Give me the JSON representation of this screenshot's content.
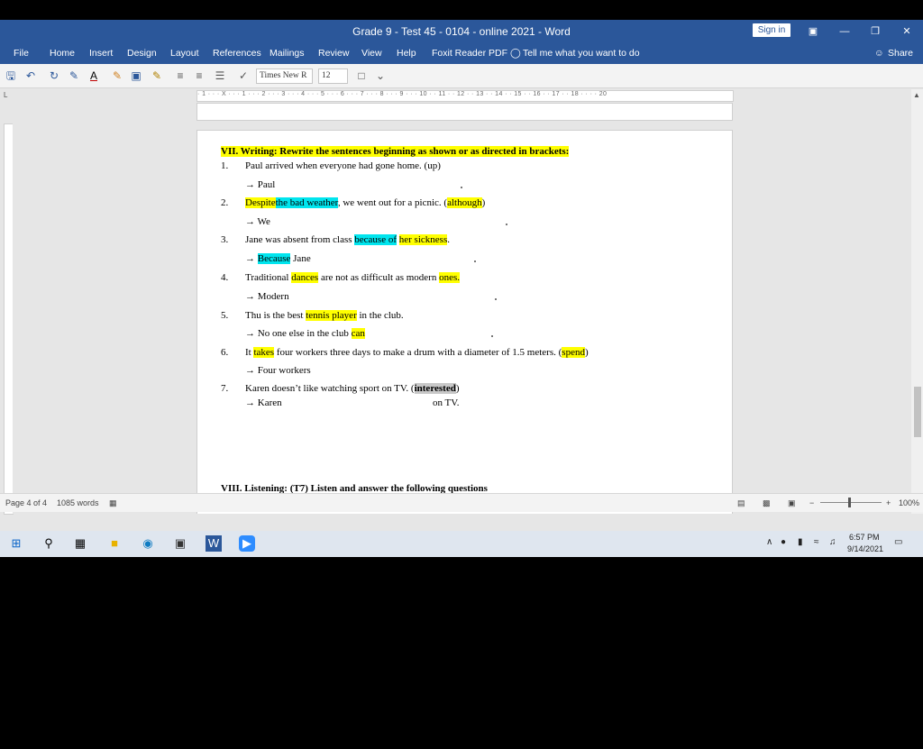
{
  "window": {
    "title": "Grade 9 - Test 45 - 0104 - online 2021  -  Word",
    "sign_in": "Sign in"
  },
  "ribbon": {
    "tabs": [
      "File",
      "Home",
      "Insert",
      "Design",
      "Layout",
      "References",
      "Mailings",
      "Review",
      "View",
      "Help",
      "Foxit Reader PDF"
    ],
    "tell_me": "Tell me what you want to do",
    "share": "Share"
  },
  "qat": {
    "font_name": "Times New R",
    "font_size": "12"
  },
  "ruler": {
    "labels": "· 1 · · · X · · · 1 · · · 2 · · · 3 · · · 4 · · · 5 · · · 6 · · · 7 · · · 8 · · · 9 · · · 10 · · 11 · · 12 · · 13 · · 14 · · 15 · · 16 · · 17 · · 18 · · · · 20"
  },
  "document": {
    "section_vii": "VII. Writing: Rewrite the sentences beginning as shown or as directed in brackets:",
    "items": [
      {
        "num": "1.",
        "s1": "Paul arrived when everyone had gone home. (up)",
        "arrow": "→ Paul"
      },
      {
        "num": "2.",
        "despite": "Despite",
        "bad_weather": "the bad weather",
        "rest": ", we went out for a picnic. (",
        "although": "although",
        "close": ")",
        "arrow": "→ We"
      },
      {
        "num": "3.",
        "pre": "Jane was absent from class ",
        "because_of": "because of",
        "her_sickness": "her sickness",
        "end": ".",
        "arrow": "→ ",
        "because": "Because",
        "arrow_rest": " Jane"
      },
      {
        "num": "4.",
        "pre": "Traditional ",
        "dances": "dances",
        "mid": " are not as difficult as modern ",
        "ones": "ones.",
        "arrow": "→ Modern"
      },
      {
        "num": "5.",
        "pre": "Thu is the best ",
        "tennis_player": "tennis player",
        "post": " in the club.",
        "arrow": "→ No one else in the club ",
        "can": "can"
      },
      {
        "num": "6.",
        "pre": "It ",
        "takes": "takes",
        "mid": " four workers three days to make a drum with a diameter of 1.5 meters. (",
        "spend": "spend",
        "close": ")",
        "arrow": "→ Four workers"
      },
      {
        "num": "7.",
        "pre": "Karen doesn’t like watching sport on TV. (",
        "interested": "interested",
        "close": ")",
        "arrow": "→ Karen",
        "on_tv": "on TV."
      }
    ],
    "section_viii": "VIII.   Listening: (T7) Listen and answer the following questions"
  },
  "status": {
    "page": "Page 4 of 4",
    "words": "1085 words",
    "zoom": "100%"
  },
  "tray": {
    "time": "6:57 PM",
    "date": "9/14/2021"
  },
  "colors": {
    "word_blue": "#2b579a",
    "highlight_yellow": "#ffff00",
    "highlight_cyan": "#00e5ee"
  }
}
